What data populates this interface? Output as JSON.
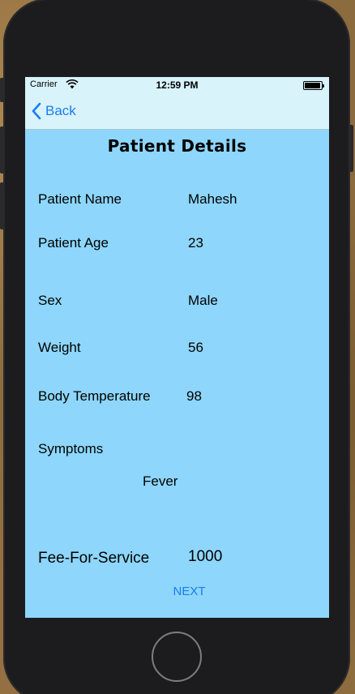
{
  "status_bar": {
    "carrier": "Carrier",
    "time": "12:59 PM"
  },
  "nav": {
    "back_label": "Back"
  },
  "page": {
    "title": "Patient Details"
  },
  "fields": {
    "patient_name": {
      "label": "Patient Name",
      "value": "Mahesh"
    },
    "patient_age": {
      "label": "Patient Age",
      "value": "23"
    },
    "sex": {
      "label": "Sex",
      "value": "Male"
    },
    "weight": {
      "label": "Weight",
      "value": "56"
    },
    "body_temperature": {
      "label": "Body Temperature",
      "value": "98"
    },
    "symptoms": {
      "label": "Symptoms",
      "value": "Fever"
    },
    "fee": {
      "label": "Fee-For-Service",
      "value": "1000"
    }
  },
  "actions": {
    "next_label": "NEXT"
  },
  "colors": {
    "screen_background": "#8ed6fb",
    "nav_background": "#d8f3fa",
    "accent": "#1a7cf5"
  },
  "icons": {
    "back": "chevron-left-icon",
    "wifi": "wifi-icon",
    "battery": "battery-icon"
  }
}
